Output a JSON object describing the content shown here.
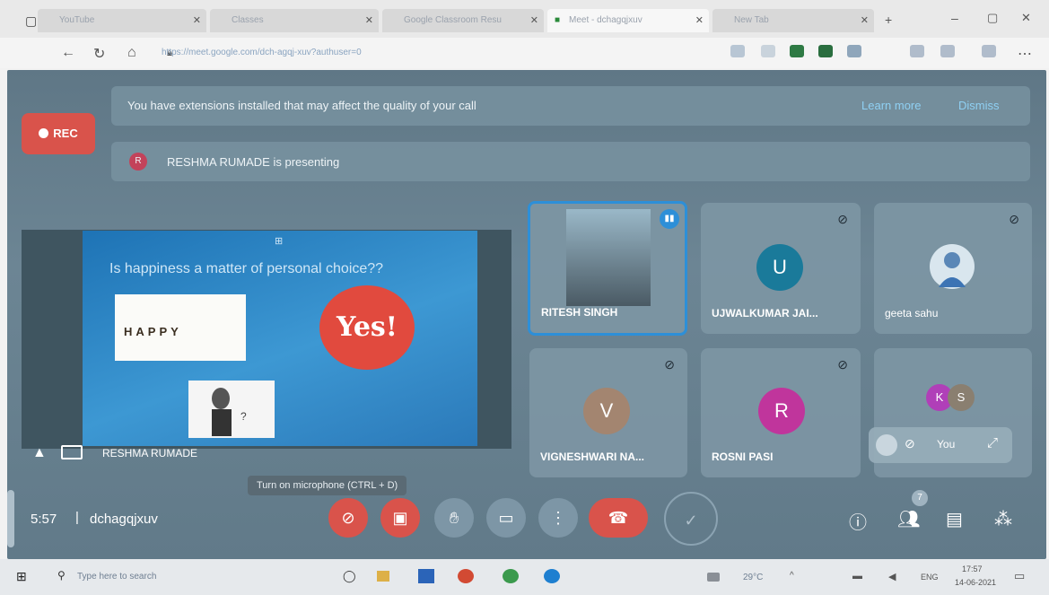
{
  "browser": {
    "tabs": [
      {
        "label": "YouTube"
      },
      {
        "label": "Classes"
      },
      {
        "label": "Google Classroom Resu"
      },
      {
        "label": "Meet - dchagqjxuv"
      },
      {
        "label": "New Tab"
      }
    ],
    "url": "https://meet.google.com/dch-agqj-xuv?authuser=0"
  },
  "meet": {
    "rec_label": "REC",
    "extensions_banner": {
      "text": "You have extensions installed that may affect the quality of your call",
      "learn_more": "Learn more",
      "dismiss": "Dismiss"
    },
    "presenting_banner": {
      "avatar_letter": "R",
      "text": "RESHMA RUMADE is presenting"
    },
    "presentation": {
      "presenter_name": "RESHMA RUMADE",
      "slide_title": "Is happiness a matter of personal choice??",
      "happy_text": "HAPPY",
      "yes_text": "Yes!"
    },
    "participants": [
      {
        "name": "RITESH SINGH",
        "type": "video"
      },
      {
        "name": "UJWALKUMAR JAI...",
        "letter": "U",
        "color": "#1a7a9a"
      },
      {
        "name": "geeta sahu",
        "type": "photo"
      },
      {
        "name": "VIGNESHWARI NA...",
        "letter": "V",
        "color": "#a38570"
      },
      {
        "name": "ROSNI PASI",
        "letter": "R",
        "color": "#c0359c"
      },
      {
        "letters": [
          "K",
          "S"
        ],
        "colors": [
          "#b03fb8",
          "#8a7f70"
        ]
      }
    ],
    "you_label": "You",
    "tooltip": "Turn on microphone (CTRL + D)",
    "clock": "5:57",
    "meeting_code": "dchagqjxuv",
    "people_count": "7"
  },
  "taskbar": {
    "search_placeholder": "Type here to search",
    "temperature": "29°C",
    "lang": "ENG",
    "time": "17:57",
    "date": "14-06-2021"
  }
}
